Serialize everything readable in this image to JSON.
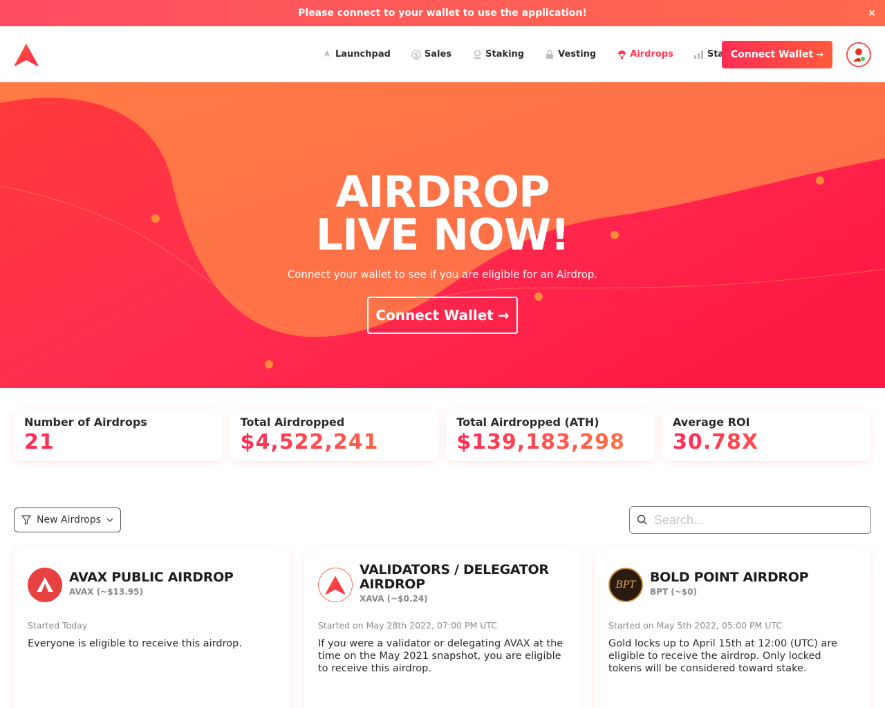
{
  "banner": {
    "text": "Please connect to your wallet to use the application!",
    "close": "×"
  },
  "nav": {
    "items": [
      {
        "label": "Launchpad",
        "icon": "rocket-icon",
        "active": false
      },
      {
        "label": "Sales",
        "icon": "dollar-icon",
        "active": false
      },
      {
        "label": "Staking",
        "icon": "coin-icon",
        "active": false
      },
      {
        "label": "Vesting",
        "icon": "lock-icon",
        "active": false
      },
      {
        "label": "Airdrops",
        "icon": "parachute-icon",
        "active": true
      },
      {
        "label": "Stats",
        "icon": "bar-chart-icon",
        "active": false
      }
    ],
    "connect_label": "Connect Wallet"
  },
  "hero": {
    "title_line1": "AIRDROP",
    "title_line2": "LIVE NOW!",
    "subtitle": "Connect your wallet to see if you are eligible for an Airdrop.",
    "button_label": "Connect Wallet"
  },
  "stats": [
    {
      "label": "Number of Airdrops",
      "value": "21"
    },
    {
      "label": "Total Airdropped",
      "value": "$4,522,241"
    },
    {
      "label": "Total Airdropped (ATH)",
      "value": "$139,183,298"
    },
    {
      "label": "Average ROI",
      "value": "30.78X"
    }
  ],
  "filter": {
    "label": "New Airdrops"
  },
  "search": {
    "placeholder": "Search..."
  },
  "cards": [
    {
      "title": "AVAX PUBLIC AIRDROP",
      "token": "AVAX (~$13.95)",
      "started": "Started Today",
      "description": "Everyone is eligible to receive this airdrop.",
      "logo": "avax-logo-icon"
    },
    {
      "title": "VALIDATORS / DELEGATOR AIRDROP",
      "token": "XAVA (~$0.24)",
      "started": "Started on May 28th 2022, 07:00 PM UTC",
      "description": "If you were a validator or delegating AVAX at the time on the May 2021 snapshot, you are eligible to receive this airdrop.",
      "logo": "xava-logo-icon"
    },
    {
      "title": "BOLD POINT AIRDROP",
      "token": "BPT (~$0)",
      "started": "Started on May 5th 2022, 05:00 PM UTC",
      "description": "Gold locks up to April 15th at 12:00 (UTC) are eligible to receive the airdrop. Only locked tokens will be considered toward stake.",
      "logo": "bpt-logo-icon",
      "logo_text": "BPT"
    }
  ],
  "colors": {
    "brand": "#ff3a55",
    "accent": "#ff6a45"
  }
}
